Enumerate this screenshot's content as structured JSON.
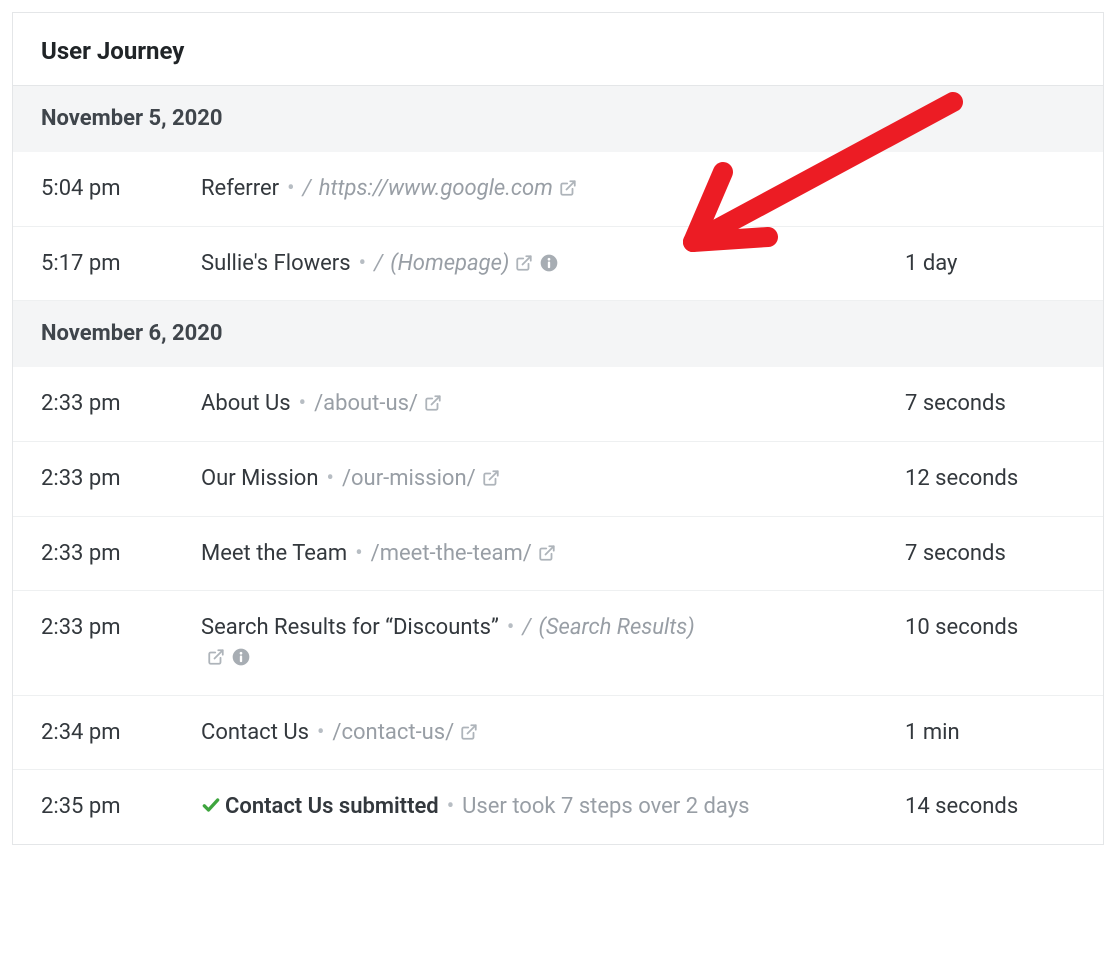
{
  "panel": {
    "title": "User Journey"
  },
  "groups": [
    {
      "date": "November 5, 2020",
      "rows": [
        {
          "time": "5:04 pm",
          "title": "Referrer",
          "title_bold": false,
          "path": "https://www.google.com",
          "path_style": "italic",
          "slash_prefix": true,
          "duration": "",
          "ext_link": true,
          "info": false,
          "check": false
        },
        {
          "time": "5:17 pm",
          "title": "Sullie's Flowers",
          "title_bold": false,
          "path": "(Homepage)",
          "path_style": "italic",
          "slash_prefix": true,
          "duration": "1 day",
          "ext_link": true,
          "info": true,
          "check": false,
          "annotation_arrow": true
        }
      ]
    },
    {
      "date": "November 6, 2020",
      "rows": [
        {
          "time": "2:33 pm",
          "title": "About Us",
          "title_bold": false,
          "path": "/about-us/",
          "path_style": "plain",
          "slash_prefix": false,
          "duration": "7 seconds",
          "ext_link": true,
          "info": false,
          "check": false
        },
        {
          "time": "2:33 pm",
          "title": "Our Mission",
          "title_bold": false,
          "path": "/our-mission/",
          "path_style": "plain",
          "slash_prefix": false,
          "duration": "12 seconds",
          "ext_link": true,
          "info": false,
          "check": false
        },
        {
          "time": "2:33 pm",
          "title": "Meet the Team",
          "title_bold": false,
          "path": "/meet-the-team/",
          "path_style": "plain",
          "slash_prefix": false,
          "duration": "7 seconds",
          "ext_link": true,
          "info": false,
          "check": false
        },
        {
          "time": "2:33 pm",
          "title": "Search Results for “Discounts”",
          "title_bold": false,
          "path": "(Search Results)",
          "path_style": "italic",
          "slash_prefix": true,
          "duration": "10 seconds",
          "ext_link": true,
          "info": true,
          "check": false,
          "wrap_icons": true
        },
        {
          "time": "2:34 pm",
          "title": "Contact Us",
          "title_bold": false,
          "path": "/contact-us/",
          "path_style": "plain",
          "slash_prefix": false,
          "duration": "1 min",
          "ext_link": true,
          "info": false,
          "check": false
        },
        {
          "time": "2:35 pm",
          "title": "Contact Us submitted",
          "title_bold": true,
          "summary": "User took 7 steps over 2 days",
          "duration": "14 seconds",
          "ext_link": false,
          "info": false,
          "check": true
        }
      ]
    }
  ]
}
